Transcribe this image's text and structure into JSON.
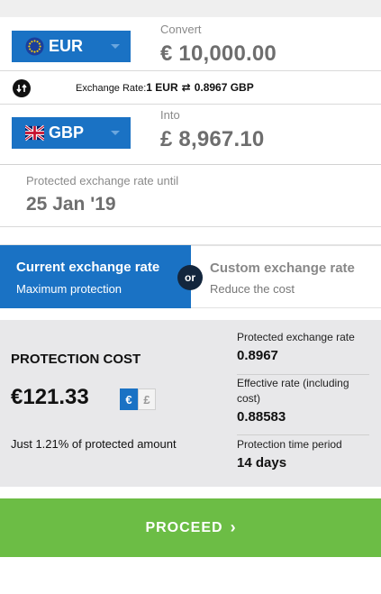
{
  "converter": {
    "from": {
      "label": "Convert",
      "currency": "EUR",
      "amount": "€ 10,000.00",
      "flag_icon": "eu-flag-icon"
    },
    "rate": {
      "label": "Exchange Rate:",
      "left": "1 EUR",
      "swap_glyph": "⇄",
      "right": "0.8967 GBP",
      "icon": "info-icon"
    },
    "to": {
      "label": "Into",
      "currency": "GBP",
      "amount": "£ 8,967.10",
      "flag_icon": "uk-flag-icon"
    },
    "until": {
      "label": "Protected exchange rate until",
      "date": "25 Jan '19"
    }
  },
  "options": {
    "current": {
      "title": "Current exchange rate",
      "subtitle": "Maximum protection",
      "selected": true
    },
    "or_label": "or",
    "custom": {
      "title": "Custom exchange rate",
      "subtitle": "Reduce the cost",
      "selected": false
    }
  },
  "cost": {
    "label": "PROTECTION COST",
    "value": "€121.33",
    "toggle_eur": "€",
    "toggle_gbp": "£",
    "note": "Just 1.21% of protected amount",
    "details": [
      {
        "label": "Protected exchange rate",
        "value": "0.8967"
      },
      {
        "label": "Effective rate (including cost)",
        "value": "0.88583"
      },
      {
        "label": "Protection time period",
        "value": "14 days"
      }
    ]
  },
  "proceed": {
    "label": "PROCEED",
    "chevron": "›"
  },
  "colors": {
    "primary": "#1a72c4",
    "proceed": "#6cbd45",
    "panel": "#e8e8ea",
    "badge": "#13263d"
  }
}
